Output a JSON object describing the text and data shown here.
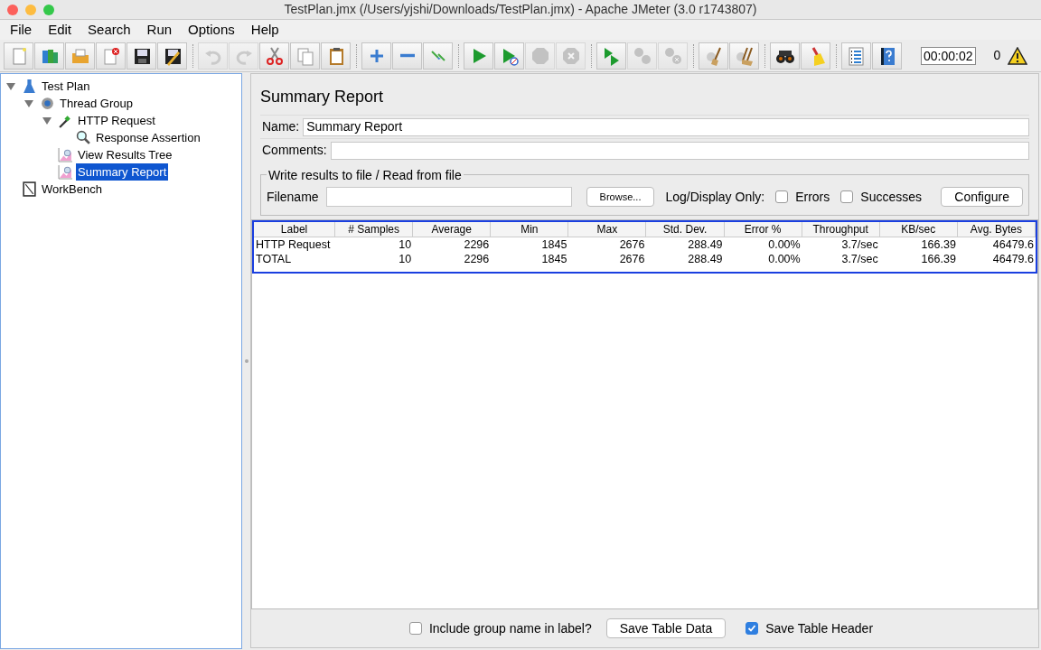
{
  "window": {
    "title": "TestPlan.jmx (/Users/yjshi/Downloads/TestPlan.jmx) - Apache JMeter (3.0 r1743807)"
  },
  "menu": [
    "File",
    "Edit",
    "Search",
    "Run",
    "Options",
    "Help"
  ],
  "toolbar": [
    [
      {
        "kind": "new",
        "disabled": false
      },
      {
        "kind": "templates",
        "disabled": false
      },
      {
        "kind": "open",
        "disabled": false
      },
      {
        "kind": "close",
        "disabled": false
      },
      {
        "kind": "save",
        "disabled": false
      },
      {
        "kind": "saveas",
        "disabled": false
      }
    ],
    [
      {
        "kind": "undo",
        "disabled": true
      },
      {
        "kind": "redo",
        "disabled": true
      },
      {
        "kind": "cut",
        "disabled": false
      },
      {
        "kind": "copy",
        "disabled": false
      },
      {
        "kind": "paste",
        "disabled": false
      }
    ],
    [
      {
        "kind": "expand",
        "disabled": false
      },
      {
        "kind": "collapse",
        "disabled": false
      },
      {
        "kind": "toggle",
        "disabled": false
      }
    ],
    [
      {
        "kind": "start",
        "disabled": false
      },
      {
        "kind": "startnopause",
        "disabled": false
      },
      {
        "kind": "stop",
        "disabled": true
      },
      {
        "kind": "shutdown",
        "disabled": true
      }
    ],
    [
      {
        "kind": "remotestart",
        "disabled": false
      },
      {
        "kind": "remotestop",
        "disabled": true
      },
      {
        "kind": "remoteexit",
        "disabled": true
      }
    ],
    [
      {
        "kind": "clear",
        "disabled": false
      },
      {
        "kind": "clearall",
        "disabled": false
      }
    ],
    [
      {
        "kind": "search",
        "disabled": false
      },
      {
        "kind": "resetsearch",
        "disabled": false
      }
    ],
    [
      {
        "kind": "functions",
        "disabled": false
      },
      {
        "kind": "help",
        "disabled": false
      }
    ]
  ],
  "timer": "00:00:02",
  "warning_count": "0",
  "tree": [
    {
      "label": "Test Plan",
      "kind": "testplan",
      "expanded": true,
      "selected": false,
      "children": [
        {
          "label": "Thread Group",
          "kind": "threadgroup",
          "expanded": true,
          "selected": false,
          "children": [
            {
              "label": "HTTP Request",
              "kind": "sampler",
              "expanded": true,
              "selected": false,
              "children": [
                {
                  "label": "Response Assertion",
                  "kind": "assertion",
                  "selected": false
                }
              ]
            },
            {
              "label": "View Results Tree",
              "kind": "listener",
              "selected": false
            },
            {
              "label": "Summary Report",
              "kind": "listener",
              "selected": true
            }
          ]
        }
      ]
    },
    {
      "label": "WorkBench",
      "kind": "workbench",
      "selected": false
    }
  ],
  "panel": {
    "title": "Summary Report",
    "name": {
      "label": "Name:",
      "value": "Summary Report"
    },
    "comments": {
      "label": "Comments:"
    },
    "file_group": {
      "title": "Write results to file / Read from file",
      "filename_label": "Filename",
      "browse": "Browse...",
      "log_label": "Log/Display Only:",
      "options": [
        {
          "label": "Errors",
          "checked": false
        },
        {
          "label": "Successes",
          "checked": false
        }
      ],
      "configure": "Configure"
    },
    "table": {
      "columns": [
        "Label",
        "# Samples",
        "Average",
        "Min",
        "Max",
        "Std. Dev.",
        "Error %",
        "Throughput",
        "KB/sec",
        "Avg. Bytes"
      ],
      "rows": [
        [
          "HTTP Request",
          "10",
          "2296",
          "1845",
          "2676",
          "288.49",
          "0.00%",
          "3.7/sec",
          "166.39",
          "46479.6"
        ],
        [
          "TOTAL",
          "10",
          "2296",
          "1845",
          "2676",
          "288.49",
          "0.00%",
          "3.7/sec",
          "166.39",
          "46479.6"
        ]
      ]
    },
    "footer": {
      "include_group": {
        "label": "Include group name in label?",
        "checked": false
      },
      "save_data": "Save Table Data",
      "save_header": {
        "label": "Save Table Header",
        "checked": true
      }
    }
  }
}
